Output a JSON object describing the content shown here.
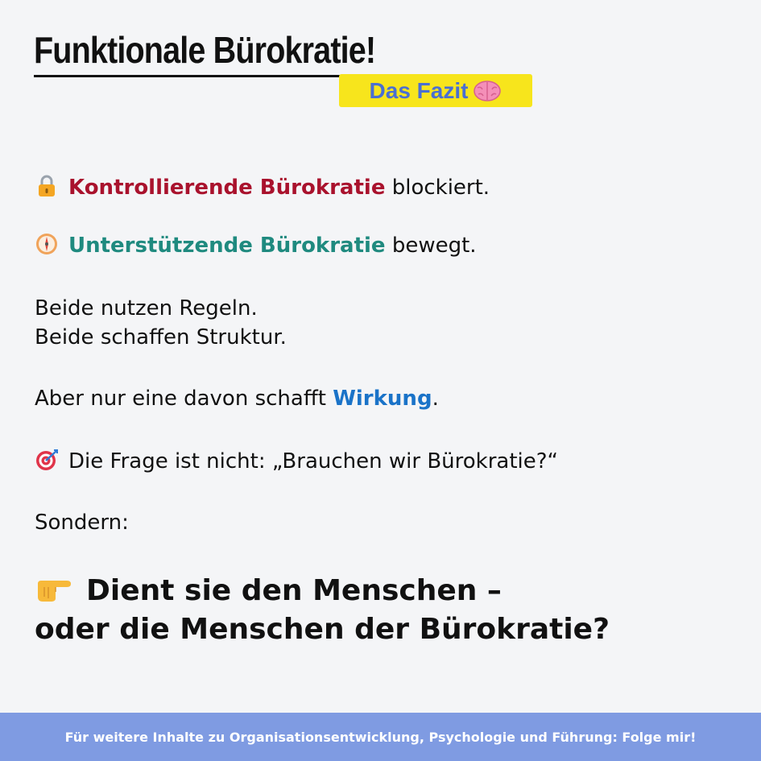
{
  "header": {
    "title": "Funktionale Bürokratie!",
    "badge_text": "Das Fazit",
    "badge_icon": "brain-icon",
    "badge_color": "#f7e51c",
    "badge_text_color": "#4a6fd2"
  },
  "content": {
    "line1": {
      "icon": "lock-icon",
      "highlight": "Kontrollierende Bürokratie",
      "rest": " blockiert.",
      "highlight_color": "#a9122d"
    },
    "line2": {
      "icon": "compass-icon",
      "highlight": "Unterstützende Bürokratie",
      "rest": " bewegt.",
      "highlight_color": "#1f8a7f"
    },
    "line3": "Beide nutzen Regeln.",
    "line4": "Beide schaffen Struktur.",
    "line5": {
      "prefix": "Aber nur eine davon schafft ",
      "highlight": "Wirkung",
      "suffix": ".",
      "highlight_color": "#1a73c8"
    },
    "line6": {
      "icon": "target-icon",
      "text": "Die Frage ist nicht: „Brauchen wir Bürokratie?“"
    },
    "line7": "Sondern:",
    "final": {
      "icon": "pointing-hand-icon",
      "line1": "Dient sie den Menschen –",
      "line2": "oder die Menschen der Bürokratie?"
    }
  },
  "footer": {
    "text": "Für weitere Inhalte zu Organisationsentwicklung, Psychologie und Führung: Folge mir!",
    "background": "#7f9be2"
  }
}
